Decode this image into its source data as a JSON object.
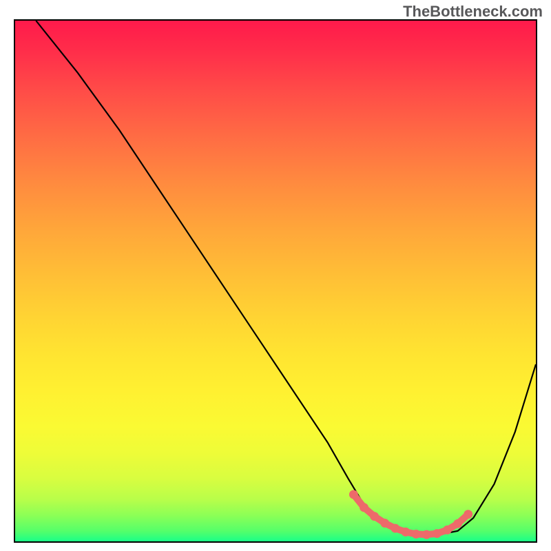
{
  "watermark": "TheBottleneck.com",
  "chart_data": {
    "type": "line",
    "title": "",
    "xlabel": "",
    "ylabel": "",
    "xlim": [
      0,
      100
    ],
    "ylim": [
      0,
      100
    ],
    "grid": false,
    "legend": false,
    "series": [
      {
        "name": "main-curve",
        "x": [
          4,
          12,
          20,
          28,
          36,
          44,
          52,
          60,
          64,
          67,
          70,
          73,
          76,
          79,
          82,
          85,
          88,
          92,
          96,
          100
        ],
        "y": [
          100,
          90,
          79,
          67,
          55,
          43,
          31,
          19,
          12,
          7,
          4,
          2.2,
          1.5,
          1.2,
          1.4,
          2,
          4.5,
          11,
          21,
          34
        ]
      },
      {
        "name": "valley-highlight",
        "x": [
          65,
          67,
          69,
          71,
          73,
          75,
          77,
          79,
          81,
          83,
          85,
          87
        ],
        "y": [
          9,
          6.5,
          4.8,
          3.5,
          2.5,
          1.8,
          1.4,
          1.3,
          1.5,
          2.2,
          3.4,
          5.2
        ]
      }
    ],
    "gradient_stops": [
      {
        "pos": 0,
        "color": "#ff1a4b"
      },
      {
        "pos": 50,
        "color": "#ffd433"
      },
      {
        "pos": 100,
        "color": "#1bff88"
      }
    ]
  }
}
